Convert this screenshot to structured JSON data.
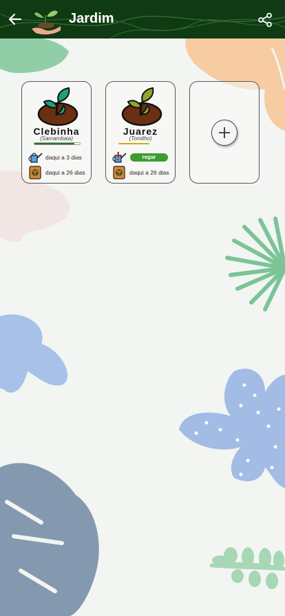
{
  "appbar": {
    "title": "Jardim",
    "back_icon": "arrow-left-icon",
    "share_icon": "share-icon",
    "logo_icon": "hand-plant-logo"
  },
  "plants": [
    {
      "name": "Clebinha",
      "species": "(Samambaia)",
      "health_level": 0.88,
      "health_color": "#1e7a22",
      "water_text": "daqui a 3 dias",
      "fertilize_text": "daqui a 26 dias"
    },
    {
      "name": "Juarez",
      "species": "(Tomilho)",
      "health_level": 0.68,
      "health_color": "#d4a90c",
      "water_button": "regar",
      "fertilize_text": "daqui a 26 dias"
    }
  ],
  "add_plant_icon": "plus-icon",
  "colors": {
    "appbar_bg": "#0f3a14",
    "background": "#f3f5f2",
    "water_button": "#3b9c2f"
  }
}
